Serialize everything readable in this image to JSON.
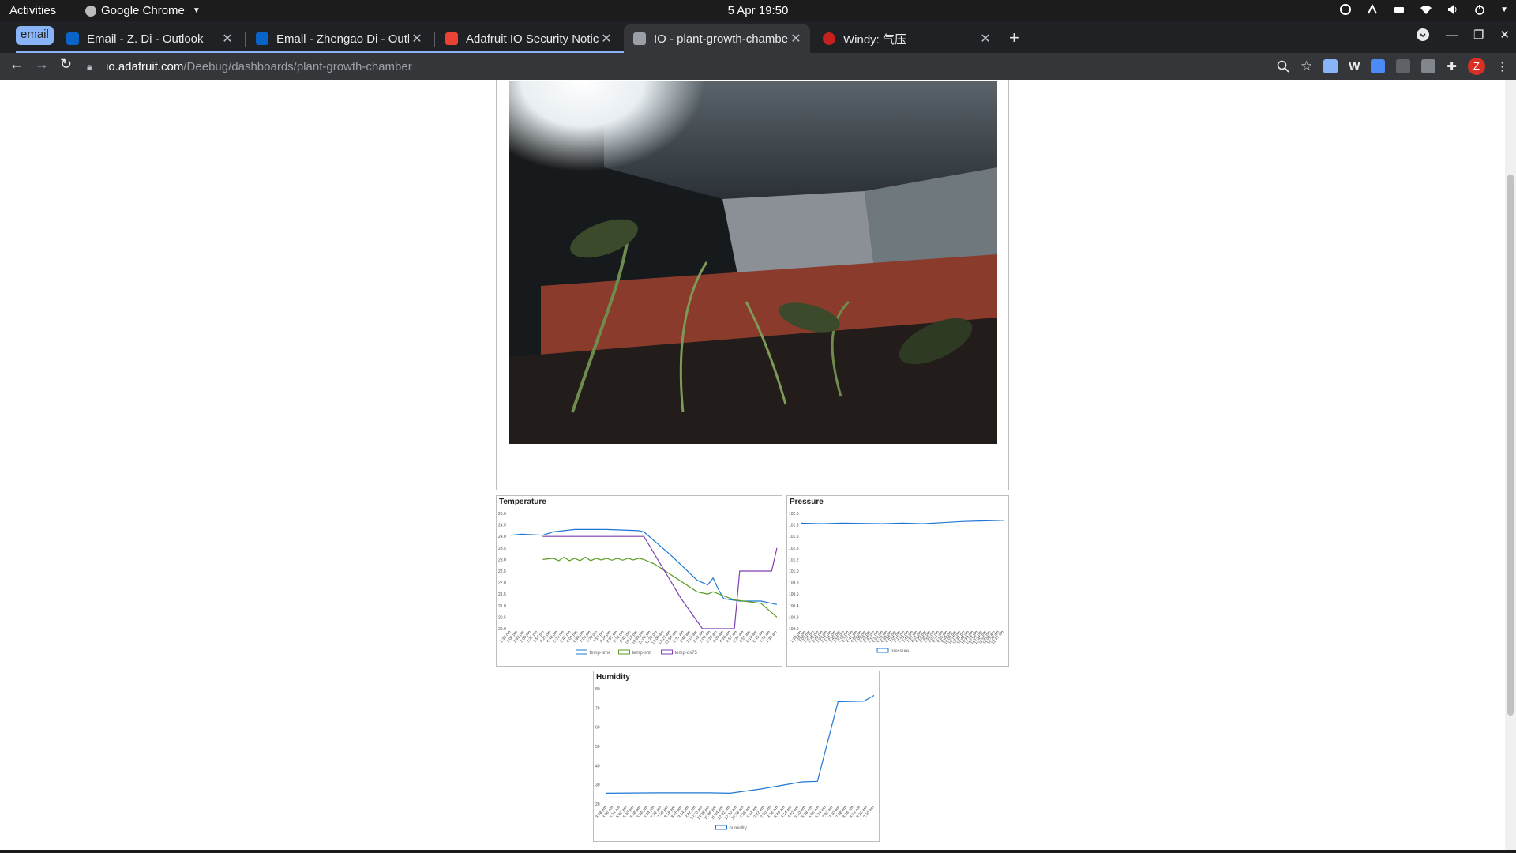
{
  "system": {
    "activities": "Activities",
    "app_name": "Google Chrome",
    "clock": "5 Apr  19:50"
  },
  "browser": {
    "tab_group_label": "email",
    "tabs": [
      {
        "title": "Email - Z. Di - Outlook",
        "favicon_color": "#0a64c8"
      },
      {
        "title": "Email - Zhengao Di - Outlo",
        "favicon_color": "#0a64c8"
      },
      {
        "title": "Adafruit IO Security Notic",
        "favicon_color": "#ea4335"
      },
      {
        "title": "IO - plant-growth-chambe",
        "favicon_color": "#9aa0a6"
      },
      {
        "title": "Windy: 气压",
        "favicon_color": "#c5221f"
      }
    ],
    "url_host": "io.adafruit.com",
    "url_path": "/Deebug/dashboards/plant-growth-chamber",
    "avatar_letter": "Z"
  },
  "chart_data": [
    {
      "type": "line",
      "title": "Temperature",
      "ylim": [
        20.0,
        25.0
      ],
      "yticks": [
        "25.0",
        "24.5",
        "24.0",
        "23.5",
        "23.0",
        "22.5",
        "22.0",
        "21.5",
        "21.0",
        "20.5",
        "20.0"
      ],
      "x": [
        "1:39 pm",
        "2:06 pm",
        "2:33 pm",
        "3:00 pm",
        "3:27 pm",
        "3:54 pm",
        "4:21 pm",
        "4:48 pm",
        "5:15 pm",
        "5:42 pm",
        "6:09 pm",
        "6:36 pm",
        "7:03 pm",
        "7:30 pm",
        "7:57 pm",
        "8:24 pm",
        "8:51 pm",
        "9:18 pm",
        "9:45 pm",
        "10:12 pm",
        "10:39 pm",
        "11:06 pm",
        "11:33 pm",
        "12:00 am",
        "12:27 am",
        "12:54 am",
        "1:21 am",
        "1:48 am",
        "2:15 am",
        "2:42 am",
        "3:09 am",
        "3:36 am",
        "4:03 am",
        "4:30 am",
        "4:57 am",
        "5:24 am",
        "5:51 am",
        "6:18 am",
        "6:45 am",
        "7:12 am",
        "7:39 am"
      ],
      "series": [
        {
          "name": "temp-bme",
          "color": "#1f77d4",
          "points": [
            [
              0,
              24.05
            ],
            [
              2,
              24.1
            ],
            [
              6,
              24.05
            ],
            [
              8,
              24.2
            ],
            [
              12,
              24.3
            ],
            [
              18,
              24.3
            ],
            [
              24,
              24.25
            ],
            [
              25,
              24.2
            ],
            [
              30,
              23.2
            ],
            [
              35,
              22.1
            ],
            [
              37,
              21.9
            ],
            [
              38,
              22.2
            ],
            [
              39,
              21.7
            ],
            [
              40,
              21.3
            ],
            [
              43,
              21.2
            ],
            [
              47,
              21.2
            ],
            [
              50,
              21.05
            ]
          ]
        },
        {
          "name": "temp-sht",
          "color": "#5a9d22",
          "points": [
            [
              6,
              23.0
            ],
            [
              8,
              23.05
            ],
            [
              9,
              22.95
            ],
            [
              10,
              23.1
            ],
            [
              11,
              22.95
            ],
            [
              12,
              23.05
            ],
            [
              13,
              22.95
            ],
            [
              14,
              23.1
            ],
            [
              15,
              22.95
            ],
            [
              16,
              23.05
            ],
            [
              17,
              22.98
            ],
            [
              18,
              23.05
            ],
            [
              19,
              22.97
            ],
            [
              20,
              23.05
            ],
            [
              21,
              22.97
            ],
            [
              22,
              23.05
            ],
            [
              23,
              22.98
            ],
            [
              24,
              23.05
            ],
            [
              25,
              23.0
            ],
            [
              27,
              22.8
            ],
            [
              35,
              21.6
            ],
            [
              37,
              21.5
            ],
            [
              38,
              21.6
            ],
            [
              42,
              21.25
            ],
            [
              47,
              21.1
            ],
            [
              48,
              20.9
            ],
            [
              50,
              20.5
            ]
          ]
        },
        {
          "name": "temp-ds75",
          "color": "#7e3fb0",
          "points": [
            [
              6,
              24.0
            ],
            [
              25,
              24.0
            ],
            [
              32,
              21.3
            ],
            [
              36,
              20.0
            ],
            [
              42,
              20.0
            ],
            [
              43,
              22.5
            ],
            [
              46,
              22.5
            ],
            [
              49,
              22.5
            ],
            [
              50,
              23.5
            ]
          ]
        }
      ],
      "xmax": 50
    },
    {
      "type": "line",
      "title": "Pressure",
      "yticks": [
        "102.0",
        "101.8",
        "101.5",
        "101.3",
        "101.2",
        "101.0",
        "100.8",
        "100.5",
        "100.4",
        "100.3",
        "100.0"
      ],
      "x": [
        "1:39 pm",
        "1:53 pm",
        "2:07 pm",
        "2:21 pm",
        "2:35 pm",
        "2:49 pm",
        "3:03 pm",
        "3:17 pm",
        "3:31 pm",
        "3:45 pm",
        "3:59 pm",
        "4:13 pm",
        "4:27 pm",
        "4:41 pm",
        "4:55 pm",
        "5:09 pm",
        "5:23 pm",
        "5:37 pm",
        "5:51 pm",
        "6:05 pm",
        "6:19 pm",
        "6:33 pm",
        "6:47 pm",
        "7:01 pm",
        "7:15 pm",
        "7:29 pm",
        "7:43 pm",
        "7:57 pm",
        "8:11 pm",
        "8:25 pm",
        "8:39 pm",
        "8:53 pm",
        "9:07 pm",
        "9:21 pm",
        "9:35 pm",
        "9:49 pm",
        "10:03 pm",
        "10:17 pm",
        "10:31 pm",
        "10:45 pm",
        "10:59 pm",
        "11:13 pm",
        "11:27 pm",
        "11:41 pm",
        "11:55 pm",
        "12:09 am",
        "12:23 am",
        "12:37 am"
      ],
      "series": [
        {
          "name": "pressure",
          "color": "#1f77d4",
          "points": [
            [
              0,
              101.83
            ],
            [
              5,
              101.82
            ],
            [
              10,
              101.83
            ],
            [
              20,
              101.82
            ],
            [
              25,
              101.83
            ],
            [
              30,
              101.82
            ],
            [
              35,
              101.84
            ],
            [
              40,
              101.86
            ],
            [
              45,
              101.87
            ],
            [
              50,
              101.88
            ]
          ]
        }
      ],
      "ylim": [
        100.0,
        102.0
      ],
      "xmax": 50
    },
    {
      "type": "line",
      "title": "Humidity",
      "ylim": [
        20,
        80
      ],
      "yticks": [
        "80",
        "70",
        "60",
        "50",
        "40",
        "30",
        "20"
      ],
      "x": [
        "3:38 pm",
        "4:06 pm",
        "4:34 pm",
        "5:02 pm",
        "5:30 pm",
        "5:58 pm",
        "6:26 pm",
        "6:54 pm",
        "7:22 pm",
        "7:50 pm",
        "8:18 pm",
        "8:46 pm",
        "9:14 pm",
        "9:42 pm",
        "10:10 pm",
        "10:38 pm",
        "11:06 pm",
        "11:34 pm",
        "12:02 am",
        "12:30 am",
        "12:58 am",
        "1:26 am",
        "1:54 am",
        "2:22 am",
        "2:50 am",
        "3:18 am",
        "3:46 am",
        "4:14 am",
        "4:42 am",
        "5:10 am",
        "5:38 am",
        "6:06 am",
        "6:34 am",
        "7:02 am",
        "7:30 am",
        "7:58 am",
        "8:26 am",
        "8:54 am",
        "9:22 am",
        "9:50 am"
      ],
      "series": [
        {
          "name": "humidity",
          "color": "#1f77d4",
          "points": [
            [
              0,
              25.6
            ],
            [
              10,
              25.8
            ],
            [
              20,
              25.8
            ],
            [
              24,
              25.6
            ],
            [
              30,
              27.8
            ],
            [
              38,
              31.5
            ],
            [
              41,
              31.8
            ],
            [
              45,
              73.2
            ],
            [
              50,
              73.5
            ],
            [
              52,
              76.5
            ]
          ]
        }
      ],
      "xmax": 52
    }
  ]
}
